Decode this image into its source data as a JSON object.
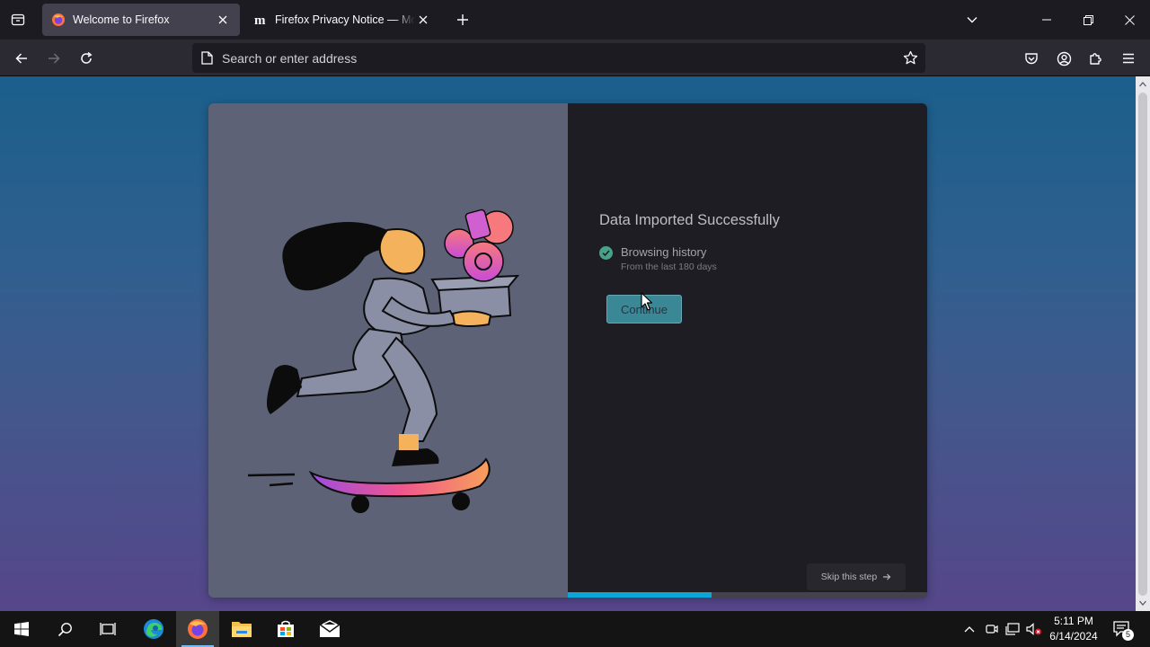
{
  "browser": {
    "tabs": [
      {
        "title": "Welcome to Firefox",
        "favicon": "firefox-icon",
        "active": true
      },
      {
        "title": "Firefox Privacy Notice — Mozilla",
        "favicon": "mozilla-m-icon",
        "active": false
      }
    ],
    "address_placeholder": "Search or enter address"
  },
  "onboarding": {
    "heading": "Data Imported Successfully",
    "item_title": "Browsing history",
    "item_subtitle": "From the last 180 days",
    "continue_label": "Continue",
    "skip_label": "Skip this step",
    "progress_fraction": 0.4
  },
  "taskbar": {
    "apps": [
      "start-icon",
      "search-icon",
      "task-view-icon",
      "edge-icon",
      "firefox-icon",
      "file-explorer-icon",
      "store-icon",
      "mail-icon"
    ],
    "time": "5:11 PM",
    "date": "6/14/2024",
    "notification_count": "5"
  },
  "colors": {
    "accent": "#0aa7d8",
    "check": "#48a189",
    "button": "#3a8796"
  }
}
